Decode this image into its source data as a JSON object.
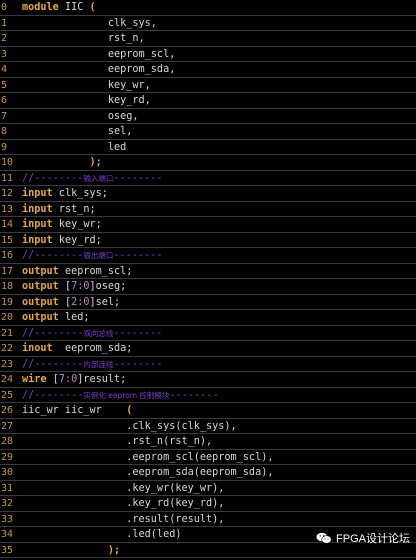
{
  "code_lines": [
    {
      "n": "0",
      "code": [
        {
          "k": "kw",
          "t": "module"
        },
        {
          "t": " IIC "
        },
        {
          "k": "kw",
          "t": "("
        }
      ]
    },
    {
      "n": "1",
      "code": [
        {
          "t": "              clk_sys,"
        }
      ]
    },
    {
      "n": "2",
      "code": [
        {
          "t": "              rst_n,"
        }
      ]
    },
    {
      "n": "3",
      "code": [
        {
          "t": "              eeprom_scl,"
        }
      ]
    },
    {
      "n": "4",
      "code": [
        {
          "t": "              eeprom_sda,"
        }
      ]
    },
    {
      "n": "5",
      "code": [
        {
          "t": "              key_wr,"
        }
      ]
    },
    {
      "n": "6",
      "code": [
        {
          "t": "              key_rd,"
        }
      ]
    },
    {
      "n": "7",
      "code": [
        {
          "t": "              oseg,"
        }
      ]
    },
    {
      "n": "8",
      "code": [
        {
          "t": "              sel,"
        }
      ]
    },
    {
      "n": "9",
      "code": [
        {
          "t": "              led"
        }
      ]
    },
    {
      "n": "10",
      "code": [
        {
          "t": "           "
        },
        {
          "k": "kw",
          "t": ");"
        }
      ]
    },
    {
      "n": "11",
      "code": [
        {
          "k": "cm",
          "t": "//--------"
        },
        {
          "k": "cmt",
          "t": "输入端口"
        },
        {
          "k": "cm",
          "t": "--------"
        }
      ]
    },
    {
      "n": "12",
      "code": [
        {
          "k": "kw",
          "t": "input"
        },
        {
          "t": " clk_sys;"
        }
      ]
    },
    {
      "n": "13",
      "code": [
        {
          "k": "kw",
          "t": "input"
        },
        {
          "t": " rst_n;"
        }
      ]
    },
    {
      "n": "14",
      "code": [
        {
          "k": "kw",
          "t": "input"
        },
        {
          "t": " key_wr;"
        }
      ]
    },
    {
      "n": "15",
      "code": [
        {
          "k": "kw",
          "t": "input"
        },
        {
          "t": " key_rd;"
        }
      ]
    },
    {
      "n": "16",
      "code": [
        {
          "k": "cm",
          "t": "//--------"
        },
        {
          "k": "cmt",
          "t": "输出端口"
        },
        {
          "k": "cm",
          "t": "--------"
        }
      ]
    },
    {
      "n": "17",
      "code": [
        {
          "k": "kw",
          "t": "output"
        },
        {
          "t": " eeprom_scl;"
        }
      ]
    },
    {
      "n": "18",
      "code": [
        {
          "k": "kw",
          "t": "output"
        },
        {
          "t": " ["
        },
        {
          "k": "num",
          "t": "7:0"
        },
        {
          "t": "]oseg;"
        }
      ]
    },
    {
      "n": "19",
      "code": [
        {
          "k": "kw",
          "t": "output"
        },
        {
          "t": " ["
        },
        {
          "k": "num",
          "t": "2:0"
        },
        {
          "t": "]sel;"
        }
      ]
    },
    {
      "n": "20",
      "code": [
        {
          "k": "kw",
          "t": "output"
        },
        {
          "t": " led;"
        }
      ]
    },
    {
      "n": "21",
      "code": [
        {
          "k": "cm",
          "t": "//--------"
        },
        {
          "k": "cmt",
          "t": "双向总线"
        },
        {
          "k": "cm",
          "t": "--------"
        }
      ]
    },
    {
      "n": "22",
      "code": [
        {
          "k": "kw",
          "t": "inout"
        },
        {
          "t": "  eeprom_sda;"
        }
      ]
    },
    {
      "n": "23",
      "code": [
        {
          "k": "cm",
          "t": "//--------"
        },
        {
          "k": "cmt",
          "t": "内部连线"
        },
        {
          "k": "cm",
          "t": "--------"
        }
      ]
    },
    {
      "n": "24",
      "code": [
        {
          "k": "kw",
          "t": "wire"
        },
        {
          "t": " ["
        },
        {
          "k": "num",
          "t": "7:0"
        },
        {
          "t": "]result;"
        }
      ]
    },
    {
      "n": "25",
      "code": [
        {
          "k": "cm",
          "t": "//--------"
        },
        {
          "k": "cmt",
          "t": "实例化 eeprom 控制模块"
        },
        {
          "k": "cm",
          "t": "--------"
        }
      ]
    },
    {
      "n": "26",
      "code": [
        {
          "t": "iic_wr iic_wr    "
        },
        {
          "k": "kw",
          "t": "("
        }
      ]
    },
    {
      "n": "27",
      "code": [
        {
          "t": "                 .clk_sys(clk_sys),"
        }
      ]
    },
    {
      "n": "28",
      "code": [
        {
          "t": "                 .rst_n(rst_n),"
        }
      ]
    },
    {
      "n": "29",
      "code": [
        {
          "t": "                 .eeprom_scl(eeprom_scl),"
        }
      ]
    },
    {
      "n": "30",
      "code": [
        {
          "t": "                 .eeprom_sda(eeprom_sda),"
        }
      ]
    },
    {
      "n": "31",
      "code": [
        {
          "t": "                 .key_wr(key_wr),"
        }
      ]
    },
    {
      "n": "32",
      "code": [
        {
          "t": "                 .key_rd(key_rd),"
        }
      ]
    },
    {
      "n": "33",
      "code": [
        {
          "t": "                 .result(result),"
        }
      ]
    },
    {
      "n": "34",
      "code": [
        {
          "t": "                 .led(led)"
        }
      ]
    },
    {
      "n": "35",
      "code": [
        {
          "t": "              "
        },
        {
          "k": "kw",
          "t": ");"
        }
      ]
    }
  ],
  "watermark": {
    "text": "FPGA设计论坛",
    "icon": "wechat-icon",
    "color": "#ffffff"
  },
  "colors": {
    "background": "#000000",
    "keyword": "#e8a73a",
    "comment": "#7a3fd0",
    "number": "#c07fd8",
    "line_number": "#c8963c",
    "text": "#d8d8d8"
  }
}
